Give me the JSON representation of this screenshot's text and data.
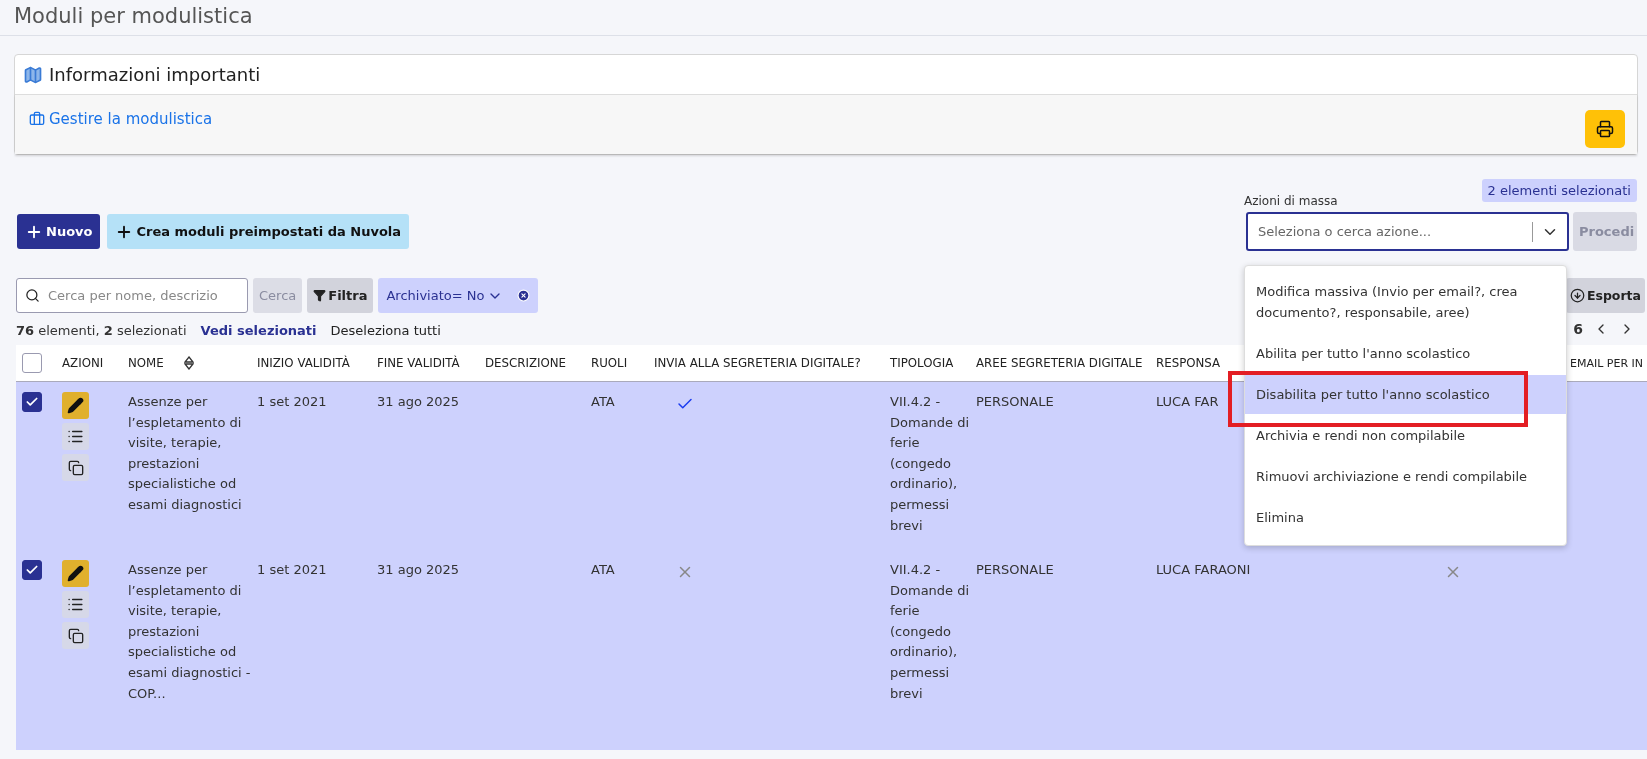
{
  "page_title": "Moduli per modulistica",
  "info_panel": {
    "title": "Informazioni importanti",
    "link": "Gestire la modulistica"
  },
  "toolbar": {
    "buttons": [
      {
        "label": "Nuovo",
        "kind": "primary"
      },
      {
        "label": "Crea moduli preimpostati da Nuvola",
        "kind": "secondary"
      }
    ]
  },
  "bulk_actions": {
    "selected_badge": "2 elementi selezionati",
    "label": "Azioni di massa",
    "placeholder": "Seleziona o cerca azione...",
    "proceed_button": "Procedi",
    "expanded": true,
    "menu": [
      {
        "label": "Modifica massiva (Invio per email?, crea documento?, responsabile, aree)",
        "selected": false,
        "annotated": false
      },
      {
        "label": "Abilita per tutto l'anno scolastico",
        "selected": false,
        "annotated": false
      },
      {
        "label": "Disabilita per tutto l'anno scolastico",
        "selected": true,
        "annotated": true
      },
      {
        "label": "Archivia e rendi non compilabile",
        "selected": false,
        "annotated": false
      },
      {
        "label": "Rimuovi archiviazione e rendi compilabile",
        "selected": false,
        "annotated": false
      },
      {
        "label": "Elimina",
        "selected": false,
        "annotated": false
      }
    ]
  },
  "search": {
    "placeholder": "Cerca per nome, descrizio",
    "button": "Cerca",
    "filter_button": "Filtra",
    "chip": "Archiviato= No"
  },
  "export_button": "Esporta",
  "pagination": {
    "page_fragment": "6"
  },
  "summary": {
    "text": "**76** elementi, **2** selezionati",
    "view_selected": "Vedi selezionati",
    "deselect_all": "Deseleziona tutti"
  },
  "table": {
    "header_checked": false,
    "columns": [
      "AZIONI",
      "NOME",
      "INIZIO VALIDITÀ",
      "FINE VALIDITÀ",
      "DESCRIZIONE",
      "RUOLI",
      "INVIA ALLA SEGRETERIA DIGITALE?",
      "TIPOLOGIA",
      "AREE SEGRETERIA DIGITALE",
      "RESPONSA",
      "EMAIL PER IN"
    ],
    "rows": [
      {
        "checked": true,
        "name": "Assenze per l’espletamento di visite, terapie, prestazioni specialistiche od esami diagnostici",
        "valid_from": "1 set 2021",
        "valid_to": "31 ago 2025",
        "roles": "ATA",
        "send_to_digital": true,
        "type": "VII.4.2 - Domande di ferie (congedo ordinario), permessi brevi",
        "areas": "PERSONALE",
        "manager": "LUCA FAR"
      },
      {
        "checked": true,
        "name": "Assenze per l’espletamento di visite, terapie, prestazioni specialistiche od esami diagnostici - COP...",
        "valid_from": "1 set 2021",
        "valid_to": "31 ago 2025",
        "roles": "ATA",
        "send_to_digital": false,
        "type": "VII.4.2 - Domande di ferie (congedo ordinario), permessi brevi",
        "areas": "PERSONALE",
        "manager": "LUCA FARAONI",
        "column_11": false
      }
    ]
  }
}
